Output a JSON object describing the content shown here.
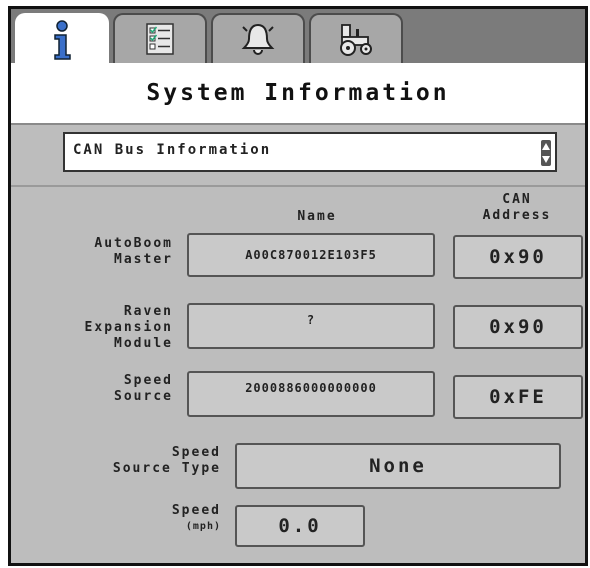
{
  "tabs": [
    {
      "name": "info",
      "icon": "info-icon",
      "active": true
    },
    {
      "name": "checklist",
      "icon": "checklist-icon",
      "active": false
    },
    {
      "name": "alarms",
      "icon": "bell-icon",
      "active": false
    },
    {
      "name": "machine",
      "icon": "tractor-icon",
      "active": false
    }
  ],
  "title": "System Information",
  "selector": {
    "value": "CAN Bus Information"
  },
  "columns": {
    "name": "Name",
    "can_line1": "CAN",
    "can_line2": "Address"
  },
  "rows": [
    {
      "label_lines": [
        "AutoBoom",
        "Master"
      ],
      "name": "A00C870012E103F5",
      "address": "0x90"
    },
    {
      "label_lines": [
        "Raven",
        "Expansion",
        "Module"
      ],
      "name": "?",
      "address": "0x90"
    },
    {
      "label_lines": [
        "Speed",
        "Source"
      ],
      "name": "2000886000000000",
      "address": "0xFE"
    }
  ],
  "speed_source_type": {
    "label_lines": [
      "Speed",
      "Source Type"
    ],
    "value": "None"
  },
  "speed": {
    "label": "Speed",
    "unit": "(mph)",
    "value": "0.0"
  }
}
